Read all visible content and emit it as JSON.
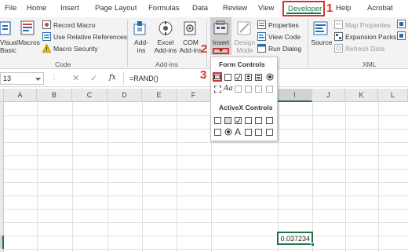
{
  "tabs": [
    "File",
    "Home",
    "Insert",
    "Page Layout",
    "Formulas",
    "Data",
    "Review",
    "View",
    "Developer",
    "Help",
    "Acrobat"
  ],
  "tabs_visible": {
    "file": "File",
    "home": "Home",
    "insert": "Insert",
    "page_layout": "Page Layout",
    "formulas": "Formulas",
    "data": "Data",
    "review": "Review",
    "view": "View",
    "developer": "Developer",
    "help": "Help",
    "acrobat": "Acrobat"
  },
  "callouts": {
    "one": "1",
    "two": "2",
    "three": "3"
  },
  "code_group": {
    "label": "Code",
    "visual_basic": [
      "Visual",
      "Basic"
    ],
    "macros": "Macros",
    "record_macro": "Record Macro",
    "relative_refs": "Use Relative References",
    "macro_security": "Macro Security"
  },
  "addins_group": {
    "label": "Add-ins",
    "addins": [
      "Add-",
      "ins"
    ],
    "excel_addins": [
      "Excel",
      "Add-ins"
    ],
    "com_addins": [
      "COM",
      "Add-ins"
    ]
  },
  "controls_group": {
    "insert": "Insert",
    "design_mode": [
      "Design",
      "Mode"
    ],
    "properties": "Properties",
    "view_code": "View Code",
    "run_dialog": "Run Dialog"
  },
  "xml_group": {
    "label": "XML",
    "source": "Source",
    "map_properties": "Map Properties",
    "expansion_packs": "Expansion Packs",
    "refresh_data": "Refresh Data"
  },
  "formula_bar": {
    "name_box": "13",
    "fx": "fx",
    "formula": "=RAND()"
  },
  "columns": [
    "A",
    "B",
    "C",
    "D",
    "E",
    "F",
    "G",
    "H",
    "I",
    "J",
    "K",
    "L"
  ],
  "selected_column": "I",
  "cell_value": "0.037234",
  "dropdown": {
    "form_controls": "Form Controls",
    "activex_controls": "ActiveX Controls",
    "aa": "Aa",
    "a_label": "A"
  },
  "colors": {
    "accent_green": "#217346",
    "callout_red": "#d9302e"
  }
}
